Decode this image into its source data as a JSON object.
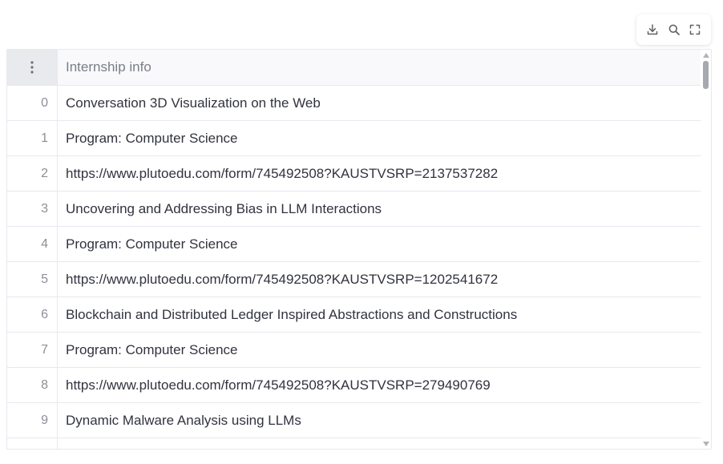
{
  "toolbar": {
    "download_icon": "download-icon",
    "search_icon": "search-icon",
    "fullscreen_icon": "fullscreen-icon"
  },
  "table": {
    "menu_icon": "vertical-ellipsis-icon",
    "column_header": "Internship info",
    "rows": [
      {
        "index": "0",
        "value": "Conversation 3D Visualization on the Web"
      },
      {
        "index": "1",
        "value": "Program: Computer Science"
      },
      {
        "index": "2",
        "value": "https://www.plutoedu.com/form/745492508?KAUSTVSRP=2137537282"
      },
      {
        "index": "3",
        "value": "Uncovering and Addressing Bias in LLM Interactions"
      },
      {
        "index": "4",
        "value": "Program: Computer Science"
      },
      {
        "index": "5",
        "value": "https://www.plutoedu.com/form/745492508?KAUSTVSRP=1202541672"
      },
      {
        "index": "6",
        "value": "Blockchain and Distributed Ledger Inspired Abstractions and Constructions"
      },
      {
        "index": "7",
        "value": "Program: Computer Science"
      },
      {
        "index": "8",
        "value": "https://www.plutoedu.com/form/745492508?KAUSTVSRP=279490769"
      },
      {
        "index": "9",
        "value": "Dynamic Malware Analysis using LLMs"
      }
    ]
  },
  "colors": {
    "text": "#31333f",
    "muted": "#8c8f96",
    "border": "#e6e9ef",
    "header_bg": "#f9f9fb"
  }
}
